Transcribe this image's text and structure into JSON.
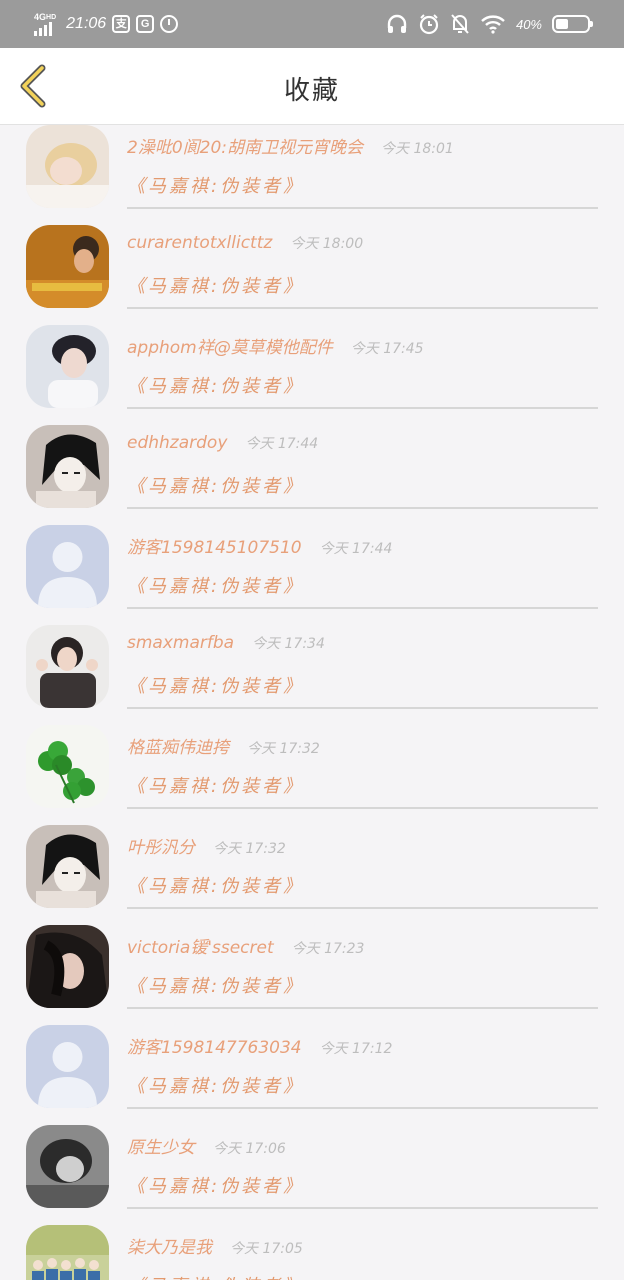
{
  "status_bar": {
    "network": "4G",
    "network_sub": "HD",
    "time": "21:06",
    "app_icon_1": "支",
    "app_icon_2": "G",
    "battery": "40%"
  },
  "header": {
    "title": "收藏",
    "back_icon": "chevron-left-icon"
  },
  "items": [
    {
      "name": "2澡吡0阆20:胡南卫视元宵晚会",
      "time": "今天 18:01",
      "tag": "《马嘉祺:伪装者》",
      "avatar": "blond"
    },
    {
      "name": "curarentotxllicttz",
      "time": "今天 18:00",
      "tag": "《马嘉祺:伪装者》",
      "avatar": "warm"
    },
    {
      "name": "apphom祥@莫草模他配件",
      "time": "今天 17:45",
      "tag": "《马嘉祺:伪装者》",
      "avatar": "boy"
    },
    {
      "name": "edhhzardoy",
      "time": "今天 17:44",
      "tag": "《马嘉祺:伪装者》",
      "avatar": "anime"
    },
    {
      "name": "游客1598145107510",
      "time": "今天 17:44",
      "tag": "《马嘉祺:伪装者》",
      "avatar": "default"
    },
    {
      "name": "smaxmarfba",
      "time": "今天 17:34",
      "tag": "《马嘉祺:伪装者》",
      "avatar": "girl"
    },
    {
      "name": "格蓝痴伟迪挎",
      "time": "今天 17:32",
      "tag": "《马嘉祺:伪装者》",
      "avatar": "clover"
    },
    {
      "name": "叶彤汎分",
      "time": "今天 17:32",
      "tag": "《马嘉祺:伪装者》",
      "avatar": "anime"
    },
    {
      "name": "victoria锾'ssecret",
      "time": "今天 17:23",
      "tag": "《马嘉祺:伪装者》",
      "avatar": "dark"
    },
    {
      "name": "游客1598147763034",
      "time": "今天 17:12",
      "tag": "《马嘉祺:伪装者》",
      "avatar": "default"
    },
    {
      "name": "原生少女",
      "time": "今天 17:06",
      "tag": "《马嘉祺:伪装者》",
      "avatar": "bw"
    },
    {
      "name": "柒大乃是我",
      "time": "今天 17:05",
      "tag": "《马嘉祺:伪装者》",
      "avatar": "group"
    }
  ]
}
